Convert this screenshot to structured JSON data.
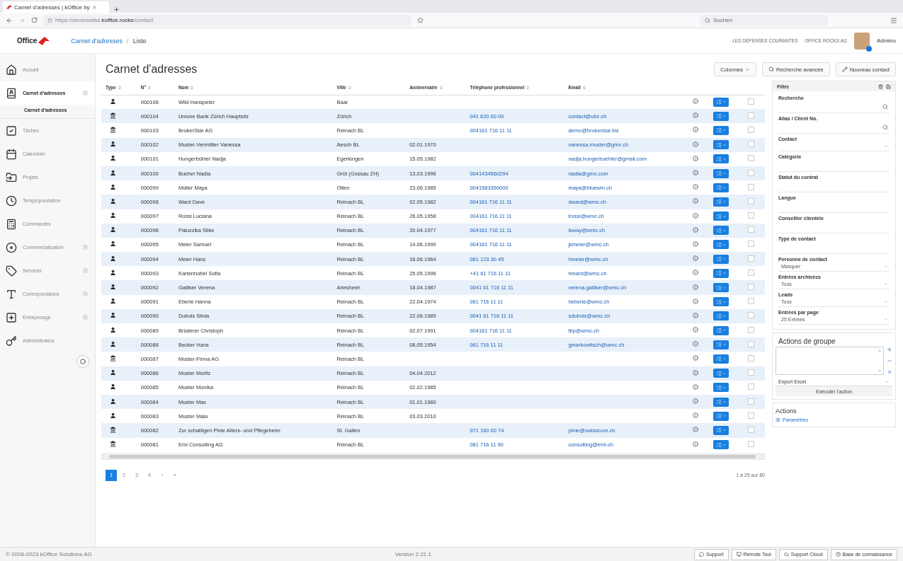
{
  "browser": {
    "tab_title": "Carnet d'adresses | kOffice by",
    "url": "https://demoswiss.**koffice.rocks**/contact",
    "search_placeholder": "Suchen"
  },
  "header": {
    "logo": "Office",
    "separator": "/",
    "breadcrumb": [
      {
        "label": "Carnet d'adresses",
        "kind": "link"
      },
      {
        "label": "Liste",
        "kind": "current"
      }
    ],
    "links": [
      "LES DÉPENSES COURANTES",
      "OFFICE ROCKS AG"
    ],
    "user": "Admino"
  },
  "sidebar": {
    "items": [
      {
        "label": "Accueil",
        "selected": false,
        "expandable": false
      },
      {
        "label": "Carnet d'adresses",
        "selected": true,
        "expandable": true,
        "children": [
          {
            "label": "Carnet d'adresses",
            "selected": true
          }
        ]
      },
      {
        "label": "Tâches",
        "selected": false,
        "expandable": false
      },
      {
        "label": "Calendrier",
        "selected": false,
        "expandable": false
      },
      {
        "label": "Projets",
        "selected": false,
        "expandable": false
      },
      {
        "label": "Temps/prestation",
        "selected": false,
        "expandable": false
      },
      {
        "label": "Commandes",
        "selected": false,
        "expandable": false
      },
      {
        "label": "Commercialisation",
        "selected": false,
        "expandable": true
      },
      {
        "label": "Services",
        "selected": false,
        "expandable": true
      },
      {
        "label": "Correspondance",
        "selected": false,
        "expandable": true
      },
      {
        "label": "Entreposage",
        "selected": false,
        "expandable": true
      },
      {
        "label": "Administrateur",
        "selected": false,
        "expandable": false
      }
    ]
  },
  "page": {
    "title": "Carnet d'adresses",
    "buttons": [
      {
        "label": "Colonnes",
        "kind": "dropdown"
      },
      {
        "label": "Recherche avancée",
        "kind": "search"
      },
      {
        "label": "Nouveau contact",
        "kind": "new"
      }
    ]
  },
  "table": {
    "columns": [
      "Type",
      "N°",
      "Nom",
      "Ville",
      "Anniversaire",
      "Téléphone professionnel",
      "Email"
    ],
    "rows": [
      {
        "kind": "person",
        "no": "000106",
        "name": "Wild Hanspeter",
        "city": "Baar",
        "birthday": "",
        "phone": "",
        "email": "",
        "checked": false
      },
      {
        "kind": "company",
        "no": "000104",
        "name": "Unione Bank Zürich Hauptsitz",
        "city": "Zürich",
        "birthday": "",
        "phone": "041 620 00 00",
        "email": "contact@ubz.ch",
        "checked": false
      },
      {
        "kind": "company",
        "no": "000103",
        "name": "BrokerStar AG",
        "city": "Reinach BL",
        "birthday": "",
        "phone": "004161 716 11 11",
        "email": "demo@brokerstar.biz",
        "checked": false
      },
      {
        "kind": "person",
        "no": "000102",
        "name": "Muster-Vermittler Vanessa",
        "city": "Aesch BL",
        "birthday": "02.01.1970",
        "phone": "",
        "email": "vanessa.muster@gmx.ch",
        "checked": false
      },
      {
        "kind": "person",
        "no": "000101",
        "name": "Hungerbühler Nadja",
        "city": "Egerkingen",
        "birthday": "15.05.1982",
        "phone": "",
        "email": "nadja.hungerbuehler@gmail.com",
        "checked": false
      },
      {
        "kind": "person",
        "no": "000100",
        "name": "Bucher Nadia",
        "city": "Grüt (Gossau ZH)",
        "birthday": "13.03.1996",
        "phone": "0041434560294",
        "email": "nadia@gmx.com",
        "checked": false
      },
      {
        "kind": "person",
        "no": "000099",
        "name": "Müller Maya",
        "city": "Olten",
        "birthday": "23.06.1985",
        "phone": "0041583350000",
        "email": "maya@bluewin.ch",
        "checked": false
      },
      {
        "kind": "person",
        "no": "000098",
        "name": "Ward Dave",
        "city": "Reinach BL",
        "birthday": "02.05.1982",
        "phone": "004161 716 11 11",
        "email": "dward@wmc.ch",
        "checked": false
      },
      {
        "kind": "person",
        "no": "000097",
        "name": "Rossi Luciana",
        "city": "Reinach BL",
        "birthday": "26.05.1958",
        "phone": "004161 716 11 11",
        "email": "lrossi@wmc.ch",
        "checked": false
      },
      {
        "kind": "person",
        "no": "000096",
        "name": "Paluzzika Silke",
        "city": "Reinach BL",
        "birthday": "20.04.1977",
        "phone": "004161 716 11 11",
        "email": "lsway@wmc.ch",
        "checked": false
      },
      {
        "kind": "person",
        "no": "000095",
        "name": "Meier Samuel",
        "city": "Reinach BL",
        "birthday": "14.06.1990",
        "phone": "004161 716 11 11",
        "email": "jsmeier@wmc.ch",
        "checked": false
      },
      {
        "kind": "person",
        "no": "000094",
        "name": "Meier Hans",
        "city": "Reinach BL",
        "birthday": "16.06.1964",
        "phone": "061 123 30 45",
        "email": "hmeier@wmc.ch",
        "checked": false
      },
      {
        "kind": "person",
        "no": "000093",
        "name": "Kartenhobel Sofia",
        "city": "Reinach BL",
        "birthday": "25.05.1996",
        "phone": "+41 61 716 11 11",
        "email": "hmard@wmc.ch",
        "checked": false
      },
      {
        "kind": "person",
        "no": "000092",
        "name": "Galliker Verena",
        "city": "Arlesheim",
        "birthday": "18.04.1987",
        "phone": "0041 61 716 11 11",
        "email": "verena.galliker@wmc.ch",
        "checked": false
      },
      {
        "kind": "person",
        "no": "000091",
        "name": "Eberle Hanna",
        "city": "Reinach BL",
        "birthday": "22.04.1974",
        "phone": "061 716 11 11",
        "email": "heberle@wmc.ch",
        "checked": false
      },
      {
        "kind": "person",
        "no": "000090",
        "name": "Dubois Silvia",
        "city": "Reinach BL",
        "birthday": "22.08.1989",
        "phone": "0041 61 716 11 11",
        "email": "sdubois@wmc.ch",
        "checked": false
      },
      {
        "kind": "person",
        "no": "000089",
        "name": "Brüderer Christoph",
        "city": "Reinach BL",
        "birthday": "02.07.1991",
        "phone": "004161 716 11 11",
        "email": "tbp@wmc.ch",
        "checked": false
      },
      {
        "kind": "person",
        "no": "000088",
        "name": "Becker Hans",
        "city": "Reinach BL",
        "birthday": "08.05.1954",
        "phone": "061 716 11 11",
        "email": "gmarkowitsch@wmc.ch",
        "checked": false
      },
      {
        "kind": "company",
        "no": "000087",
        "name": "Muster-Firma AG",
        "city": "Reinach BL",
        "birthday": "",
        "phone": "",
        "email": "",
        "checked": false
      },
      {
        "kind": "person",
        "no": "000086",
        "name": "Muster Moritz",
        "city": "Reinach BL",
        "birthday": "04.04.2012",
        "phone": "",
        "email": "",
        "checked": false
      },
      {
        "kind": "person",
        "no": "000085",
        "name": "Muster Monika",
        "city": "Reinach BL",
        "birthday": "02.02.1985",
        "phone": "",
        "email": "",
        "checked": false
      },
      {
        "kind": "person",
        "no": "000084",
        "name": "Muster Max",
        "city": "Reinach BL",
        "birthday": "01.01.1980",
        "phone": "",
        "email": "",
        "checked": false
      },
      {
        "kind": "person",
        "no": "000083",
        "name": "Muster Maia",
        "city": "Reinach BL",
        "birthday": "03.03.2010",
        "phone": "",
        "email": "",
        "checked": false
      },
      {
        "kind": "company",
        "no": "000082",
        "name": "Zur schattigen Pinie Alters- und Pflegeheim",
        "city": "St. Gallen",
        "birthday": "",
        "phone": "071 160 00 74",
        "email": "pinie@swisscom.ch",
        "checked": false
      },
      {
        "kind": "company",
        "no": "000081",
        "name": "Emi Consulting AG",
        "city": "Reinach BL",
        "birthday": "",
        "phone": "081 716 11 90",
        "email": "consulting@emi.ch",
        "checked": false
      }
    ]
  },
  "pagination": {
    "pages": [
      {
        "label": "1",
        "selected": true
      },
      {
        "label": "2",
        "selected": false
      },
      {
        "label": "3",
        "selected": false
      },
      {
        "label": "4",
        "selected": false
      }
    ],
    "next": "›",
    "last": "»",
    "summary": "1 à 25 sur 80"
  },
  "filter": {
    "title": "Filtre",
    "fields": [
      {
        "label": "Recherche",
        "kind": "search"
      },
      {
        "label": "Alias / Client No.",
        "kind": "search"
      },
      {
        "label": "Contact",
        "kind": "select"
      },
      {
        "label": "Catégorie",
        "kind": "multi"
      },
      {
        "label": "Statut du contrat",
        "kind": "multi"
      },
      {
        "label": "Langue",
        "kind": "multi"
      },
      {
        "label": "Conseiller clientèle",
        "kind": "multi"
      },
      {
        "label": "Type de contact",
        "kind": "multi"
      },
      {
        "label": "Personne de contact",
        "kind": "select",
        "value": "Masquer"
      },
      {
        "label": "Entrées archivées",
        "kind": "select",
        "value": "Tous"
      },
      {
        "label": "Leads",
        "kind": "select",
        "value": "Tous"
      },
      {
        "label": "Entrées par page",
        "kind": "select",
        "value": "25 Entrées"
      }
    ]
  },
  "group_actions": {
    "title": "Actions de groupe",
    "action": "Export Excel",
    "run": "Exécuter l'action"
  },
  "actions": {
    "title": "Actions",
    "link": "Paramètres"
  },
  "footer": {
    "copyright": "© 2008-2023 kOffice Solutions AG",
    "version": "Version 2.21.1",
    "buttons": [
      "Support",
      "Remote Tool",
      "Support Cloud",
      "Base de connaissance"
    ]
  }
}
